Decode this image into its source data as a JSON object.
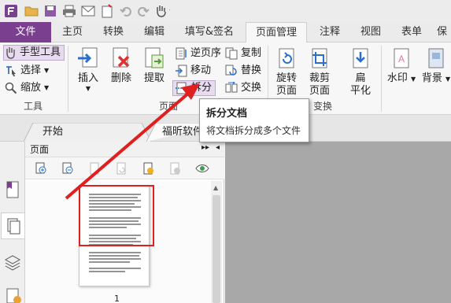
{
  "tabs": [
    {
      "label": "文件",
      "key": "file"
    },
    {
      "label": "主页",
      "key": "home"
    },
    {
      "label": "转换",
      "key": "convert"
    },
    {
      "label": "编辑",
      "key": "edit"
    },
    {
      "label": "填写&签名",
      "key": "fill-sign"
    },
    {
      "label": "页面管理",
      "key": "page-manage"
    },
    {
      "label": "注释",
      "key": "comment"
    },
    {
      "label": "视图",
      "key": "view"
    },
    {
      "label": "表单",
      "key": "form"
    },
    {
      "label": "保",
      "key": "protect"
    }
  ],
  "ribbon": {
    "tools": {
      "hand": "手型工具",
      "select": "选择",
      "zoom": "缩放",
      "group": "工具"
    },
    "insert": "插入",
    "delete": "删除",
    "extract": "提取",
    "reverse": "逆页序",
    "move": "移动",
    "split": "拆分",
    "copy": "复制",
    "replace": "替换",
    "swap": "交换",
    "pages_group": "页面",
    "rotate": [
      "旋转",
      "页面"
    ],
    "crop": [
      "裁剪",
      "页面"
    ],
    "flatten": [
      "扁",
      "平化"
    ],
    "transform_group": "变换",
    "watermark": "水印",
    "background": "背景"
  },
  "doc_tabs": {
    "start": "开始",
    "doc": "福昕软件"
  },
  "panel": {
    "title": "页面",
    "page_number": "1"
  },
  "tooltip": {
    "title": "拆分文档",
    "desc": "将文档拆分成多个文件"
  },
  "colors": {
    "accent": "#7b3f8f",
    "annotation": "#e02020"
  }
}
